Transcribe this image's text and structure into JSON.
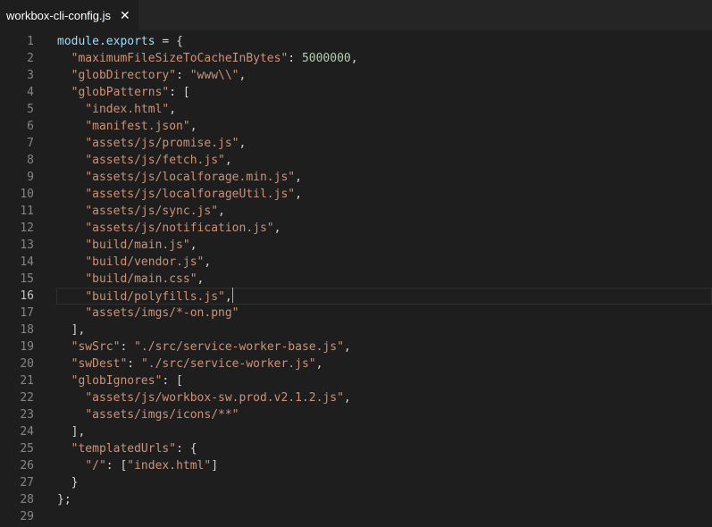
{
  "tab": {
    "title": "workbox-cli-config.js",
    "close_glyph": "✕"
  },
  "colors": {
    "plain": "#d4d4d4",
    "string": "#ce9178",
    "number": "#b5cea8",
    "identifier": "#9cdcfe",
    "line_number": "#858585"
  },
  "editor": {
    "active_line": 16,
    "lines": [
      {
        "n": "1",
        "tokens": [
          [
            "v",
            "module"
          ],
          [
            "p",
            "."
          ],
          [
            "v",
            "exports"
          ],
          [
            "p",
            " = {"
          ]
        ]
      },
      {
        "n": "2",
        "tokens": [
          [
            "p",
            "  "
          ],
          [
            "s",
            "\"maximumFileSizeToCacheInBytes\""
          ],
          [
            "p",
            ": "
          ],
          [
            "num",
            "5000000"
          ],
          [
            "p",
            ","
          ]
        ]
      },
      {
        "n": "3",
        "tokens": [
          [
            "p",
            "  "
          ],
          [
            "s",
            "\"globDirectory\""
          ],
          [
            "p",
            ": "
          ],
          [
            "s",
            "\"www\\\\\""
          ],
          [
            "p",
            ","
          ]
        ]
      },
      {
        "n": "4",
        "tokens": [
          [
            "p",
            "  "
          ],
          [
            "s",
            "\"globPatterns\""
          ],
          [
            "p",
            ": ["
          ]
        ]
      },
      {
        "n": "5",
        "tokens": [
          [
            "p",
            "    "
          ],
          [
            "s",
            "\"index.html\""
          ],
          [
            "p",
            ","
          ]
        ]
      },
      {
        "n": "6",
        "tokens": [
          [
            "p",
            "    "
          ],
          [
            "s",
            "\"manifest.json\""
          ],
          [
            "p",
            ","
          ]
        ]
      },
      {
        "n": "7",
        "tokens": [
          [
            "p",
            "    "
          ],
          [
            "s",
            "\"assets/js/promise.js\""
          ],
          [
            "p",
            ","
          ]
        ]
      },
      {
        "n": "8",
        "tokens": [
          [
            "p",
            "    "
          ],
          [
            "s",
            "\"assets/js/fetch.js\""
          ],
          [
            "p",
            ","
          ]
        ]
      },
      {
        "n": "9",
        "tokens": [
          [
            "p",
            "    "
          ],
          [
            "s",
            "\"assets/js/localforage.min.js\""
          ],
          [
            "p",
            ","
          ]
        ]
      },
      {
        "n": "10",
        "tokens": [
          [
            "p",
            "    "
          ],
          [
            "s",
            "\"assets/js/localforageUtil.js\""
          ],
          [
            "p",
            ","
          ]
        ]
      },
      {
        "n": "11",
        "tokens": [
          [
            "p",
            "    "
          ],
          [
            "s",
            "\"assets/js/sync.js\""
          ],
          [
            "p",
            ","
          ]
        ]
      },
      {
        "n": "12",
        "tokens": [
          [
            "p",
            "    "
          ],
          [
            "s",
            "\"assets/js/notification.js\""
          ],
          [
            "p",
            ","
          ]
        ]
      },
      {
        "n": "13",
        "tokens": [
          [
            "p",
            "    "
          ],
          [
            "s",
            "\"build/main.js\""
          ],
          [
            "p",
            ","
          ]
        ]
      },
      {
        "n": "14",
        "tokens": [
          [
            "p",
            "    "
          ],
          [
            "s",
            "\"build/vendor.js\""
          ],
          [
            "p",
            ","
          ]
        ]
      },
      {
        "n": "15",
        "tokens": [
          [
            "p",
            "    "
          ],
          [
            "s",
            "\"build/main.css\""
          ],
          [
            "p",
            ","
          ]
        ]
      },
      {
        "n": "16",
        "tokens": [
          [
            "p",
            "    "
          ],
          [
            "s",
            "\"build/polyfills.js\""
          ],
          [
            "p",
            ","
          ],
          [
            "cursor",
            ""
          ]
        ]
      },
      {
        "n": "17",
        "tokens": [
          [
            "p",
            "    "
          ],
          [
            "s",
            "\"assets/imgs/*-on.png\""
          ]
        ]
      },
      {
        "n": "18",
        "tokens": [
          [
            "p",
            "  ],"
          ]
        ]
      },
      {
        "n": "19",
        "tokens": [
          [
            "p",
            "  "
          ],
          [
            "s",
            "\"swSrc\""
          ],
          [
            "p",
            ": "
          ],
          [
            "s",
            "\"./src/service-worker-base.js\""
          ],
          [
            "p",
            ","
          ]
        ]
      },
      {
        "n": "20",
        "tokens": [
          [
            "p",
            "  "
          ],
          [
            "s",
            "\"swDest\""
          ],
          [
            "p",
            ": "
          ],
          [
            "s",
            "\"./src/service-worker.js\""
          ],
          [
            "p",
            ","
          ]
        ]
      },
      {
        "n": "21",
        "tokens": [
          [
            "p",
            "  "
          ],
          [
            "s",
            "\"globIgnores\""
          ],
          [
            "p",
            ": ["
          ]
        ]
      },
      {
        "n": "22",
        "tokens": [
          [
            "p",
            "    "
          ],
          [
            "s",
            "\"assets/js/workbox-sw.prod.v2.1.2.js\""
          ],
          [
            "p",
            ","
          ]
        ]
      },
      {
        "n": "23",
        "tokens": [
          [
            "p",
            "    "
          ],
          [
            "s",
            "\"assets/imgs/icons/**\""
          ]
        ]
      },
      {
        "n": "24",
        "tokens": [
          [
            "p",
            "  ],"
          ]
        ]
      },
      {
        "n": "25",
        "tokens": [
          [
            "p",
            "  "
          ],
          [
            "s",
            "\"templatedUrls\""
          ],
          [
            "p",
            ": {"
          ]
        ]
      },
      {
        "n": "26",
        "tokens": [
          [
            "p",
            "    "
          ],
          [
            "s",
            "\"/\""
          ],
          [
            "p",
            ": ["
          ],
          [
            "s",
            "\"index.html\""
          ],
          [
            "p",
            "]"
          ]
        ]
      },
      {
        "n": "27",
        "tokens": [
          [
            "p",
            "  }"
          ]
        ]
      },
      {
        "n": "28",
        "tokens": [
          [
            "p",
            "};"
          ]
        ]
      },
      {
        "n": "29",
        "tokens": []
      }
    ]
  }
}
